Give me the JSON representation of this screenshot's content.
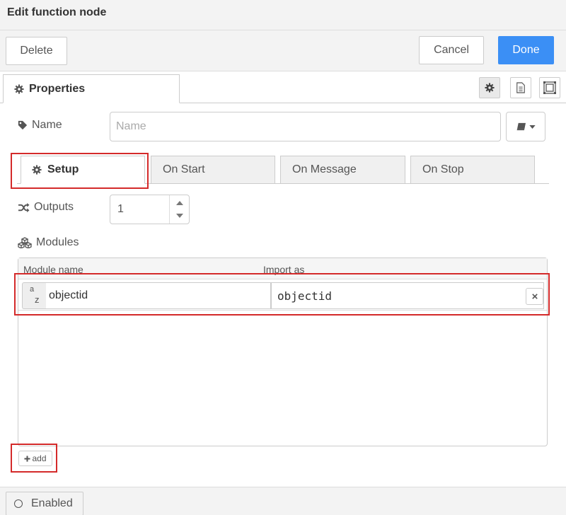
{
  "window": {
    "title": "Edit function node"
  },
  "actions": {
    "delete_label": "Delete",
    "cancel_label": "Cancel",
    "done_label": "Done"
  },
  "tabs": {
    "properties_label": "Properties"
  },
  "name_field": {
    "label": "Name",
    "placeholder": "Name",
    "value": ""
  },
  "inner_tabs": [
    "Setup",
    "On Start",
    "On Message",
    "On Stop"
  ],
  "outputs": {
    "label": "Outputs",
    "value": "1"
  },
  "modules": {
    "label": "Modules",
    "columns": {
      "name": "Module name",
      "import": "Import as"
    },
    "rows": [
      {
        "type_badge_top": "a",
        "type_badge_bottom": "z",
        "name": "objectid",
        "import_as": "objectid"
      }
    ],
    "add_label": "add"
  },
  "footer": {
    "enabled_label": "Enabled"
  },
  "colors": {
    "primary": "#3b8ff5",
    "highlight": "#d42a2a"
  }
}
